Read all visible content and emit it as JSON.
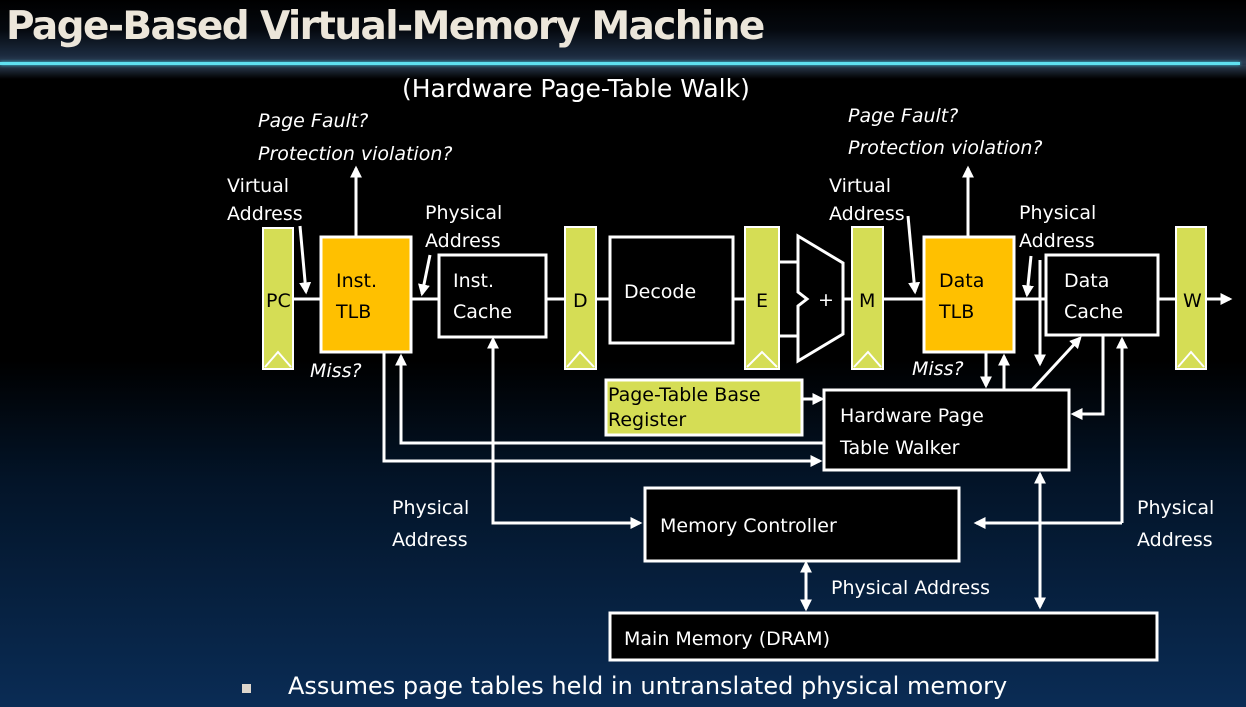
{
  "slide": {
    "title": "Page-Based Virtual-Memory Machine",
    "subtitle": "(Hardware Page-Table Walk)",
    "bullet": "Assumes page tables held in untranslated physical memory"
  },
  "colors": {
    "pipeline_register": "#d5dd55",
    "tlb": "#ffc000",
    "title_rule": "#5fe0f0",
    "title_text": "#ece6da"
  },
  "diagram": {
    "registers": {
      "pc": "PC",
      "d": "D",
      "e": "E",
      "m": "M",
      "w": "W"
    },
    "inst_tlb": {
      "line1": "Inst.",
      "line2": "TLB"
    },
    "inst_cache": {
      "line1": "Inst.",
      "line2": "Cache"
    },
    "decode": "Decode",
    "alu": "+",
    "data_tlb": {
      "line1": "Data",
      "line2": "TLB"
    },
    "data_cache": {
      "line1": "Data",
      "line2": "Cache"
    },
    "ptbr": {
      "line1": "Page-Table Base",
      "line2": "Register"
    },
    "walker": {
      "line1": "Hardware Page",
      "line2": "Table Walker"
    },
    "memory_controller": "Memory Controller",
    "main_memory": "Main Memory (DRAM)",
    "labels": {
      "page_fault": "Page Fault?",
      "protection_violation": "Protection violation?",
      "virtual": "Virtual",
      "physical": "Physical",
      "address": "Address",
      "miss": "Miss?",
      "physical_address": "Physical Address"
    }
  }
}
